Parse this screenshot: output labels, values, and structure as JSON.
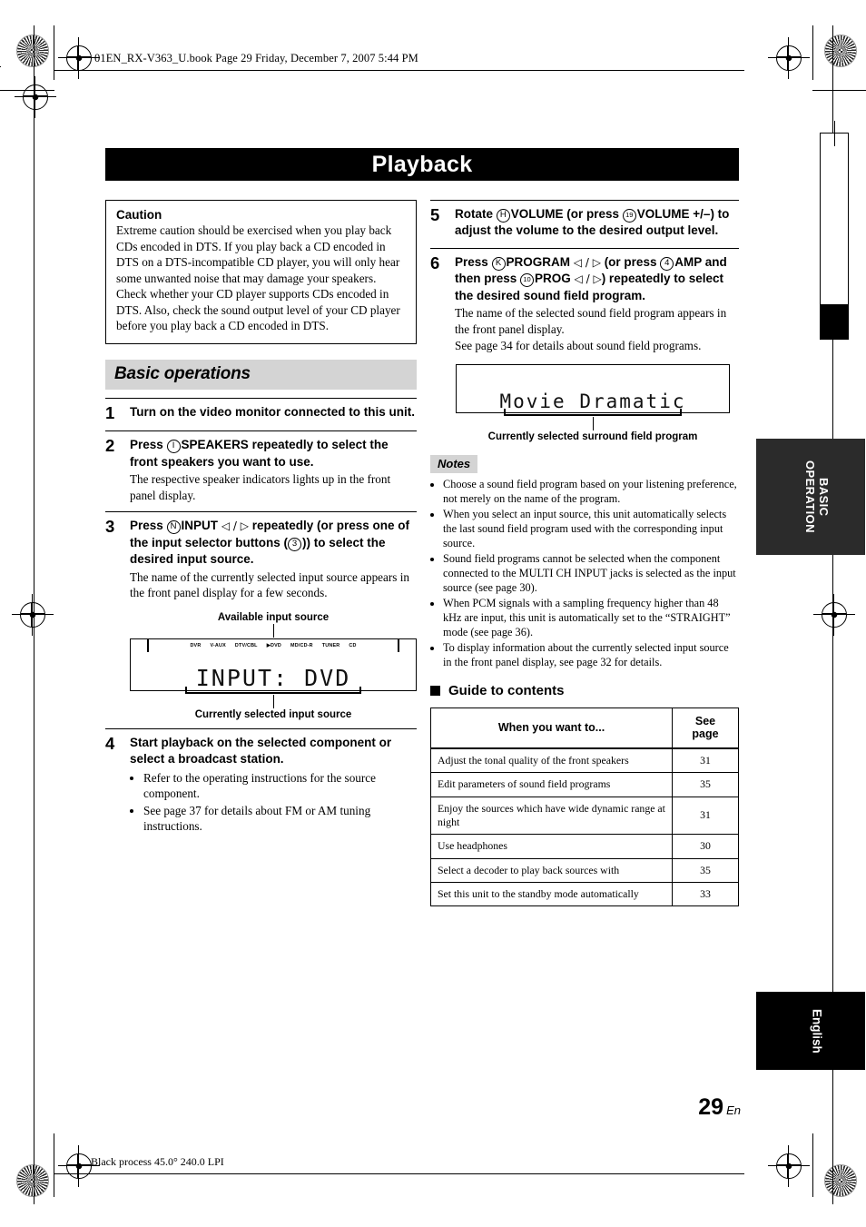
{
  "header": {
    "file_line": "01EN_RX-V363_U.book  Page 29  Friday, December 7, 2007  5:44 PM"
  },
  "title": "Playback",
  "caution": {
    "heading": "Caution",
    "text": "Extreme caution should be exercised when you play back CDs encoded in DTS. If you play back a CD encoded in DTS on a DTS-incompatible CD player, you will only hear some unwanted noise that may damage your speakers. Check whether your CD player supports CDs encoded in DTS. Also, check the sound output level of your CD player before you play back a CD encoded in DTS."
  },
  "section_heading": "Basic operations",
  "steps": [
    {
      "num": "1",
      "head_parts": [
        {
          "t": "text",
          "v": "Turn on the video monitor connected to this unit."
        }
      ],
      "sub": "",
      "bullets": []
    },
    {
      "num": "2",
      "head_parts": [
        {
          "t": "text",
          "v": "Press "
        },
        {
          "t": "circle",
          "v": "I"
        },
        {
          "t": "text",
          "v": "SPEAKERS repeatedly to select the front speakers you want to use."
        }
      ],
      "sub": "The respective speaker indicators lights up in the front panel display.",
      "bullets": []
    },
    {
      "num": "3",
      "head_parts": [
        {
          "t": "text",
          "v": "Press "
        },
        {
          "t": "circle",
          "v": "N"
        },
        {
          "t": "text",
          "v": "INPUT "
        },
        {
          "t": "arrows",
          "v": "◁ / ▷"
        },
        {
          "t": "text",
          "v": " repeatedly (or press one of the input selector buttons ("
        },
        {
          "t": "circle",
          "v": "3"
        },
        {
          "t": "text",
          "v": ")) to select the desired input source."
        }
      ],
      "sub": "The name of the currently selected input source appears in the front panel display for a few seconds.",
      "bullets": []
    },
    {
      "num": "4",
      "head_parts": [
        {
          "t": "text",
          "v": "Start playback on the selected component or select a broadcast station."
        }
      ],
      "sub": "",
      "bullets": [
        "Refer to the operating instructions for the source component.",
        "See page 37 for details about FM or AM tuning instructions."
      ]
    },
    {
      "num": "5",
      "head_parts": [
        {
          "t": "text",
          "v": "Rotate "
        },
        {
          "t": "circle",
          "v": "H"
        },
        {
          "t": "text",
          "v": "VOLUME (or press "
        },
        {
          "t": "circle",
          "v": "19"
        },
        {
          "t": "text",
          "v": "VOLUME +/–) to adjust the volume to the desired output level."
        }
      ],
      "sub": "",
      "bullets": []
    },
    {
      "num": "6",
      "head_parts": [
        {
          "t": "text",
          "v": "Press "
        },
        {
          "t": "circle",
          "v": "K"
        },
        {
          "t": "text",
          "v": "PROGRAM "
        },
        {
          "t": "arrows",
          "v": "◁ / ▷"
        },
        {
          "t": "text",
          "v": " (or press "
        },
        {
          "t": "circle",
          "v": "4"
        },
        {
          "t": "text",
          "v": "AMP and then press "
        },
        {
          "t": "circle",
          "v": "10"
        },
        {
          "t": "text",
          "v": "PROG "
        },
        {
          "t": "arrows",
          "v": "◁ / ▷"
        },
        {
          "t": "text",
          "v": ") repeatedly to select the desired sound field program."
        }
      ],
      "sub": "The name of the selected sound field program appears in the front panel display.\nSee page 34 for details about sound field programs.",
      "bullets": []
    }
  ],
  "input_figure": {
    "top_caption": "Available input source",
    "bottom_caption": "Currently selected input source",
    "source_labels": [
      "DVR",
      "V-AUX",
      "DTV/CBL",
      "▶DVD",
      "MD/CD-R",
      "TUNER",
      "CD"
    ],
    "lcd_text": "INPUT: DVD"
  },
  "program_figure": {
    "bottom_caption": "Currently selected surround field program",
    "lcd_text": "Movie Dramatic"
  },
  "notes": {
    "tag": "Notes",
    "items": [
      "Choose a sound field program based on your listening preference, not merely on the name of the program.",
      "When you select an input source, this unit automatically selects the last sound field program used with the corresponding input source.",
      "Sound field programs cannot be selected when the component connected to the MULTI CH INPUT jacks is selected as the input source (see page 30).",
      "When PCM signals with a sampling frequency higher than 48 kHz are input, this unit is automatically set to the “STRAIGHT” mode (see page 36).",
      "To display information about the currently selected input source in the front panel display, see page 32 for details."
    ]
  },
  "guide": {
    "heading": "Guide to contents",
    "columns": [
      "When you want to...",
      "See\npage"
    ],
    "col_want": "When you want to...",
    "col_see": "See",
    "col_page": "page",
    "rows": [
      {
        "want": "Adjust the tonal quality of the front speakers",
        "page": "31"
      },
      {
        "want": "Edit parameters of sound field programs",
        "page": "35"
      },
      {
        "want": "Enjoy the sources which have wide dynamic range at night",
        "page": "31"
      },
      {
        "want": "Use headphones",
        "page": "30"
      },
      {
        "want": "Select a decoder to play back sources with",
        "page": "35"
      },
      {
        "want": "Set this unit to the standby mode automatically",
        "page": "33"
      }
    ]
  },
  "side_tabs": {
    "basic_operation": "BASIC\nOPERATION",
    "basic_operation_line1": "BASIC",
    "basic_operation_line2": "OPERATION",
    "english": "English"
  },
  "page_number": {
    "number": "29",
    "suffix": "En"
  },
  "footer": {
    "text": "Black process 45.0° 240.0 LPI"
  },
  "colors": {
    "title_bar": "#000000",
    "section_heading_bg": "#d4d4d4",
    "tab_basic_bg": "#2b2b2b",
    "tab_english_bg": "#000000"
  }
}
